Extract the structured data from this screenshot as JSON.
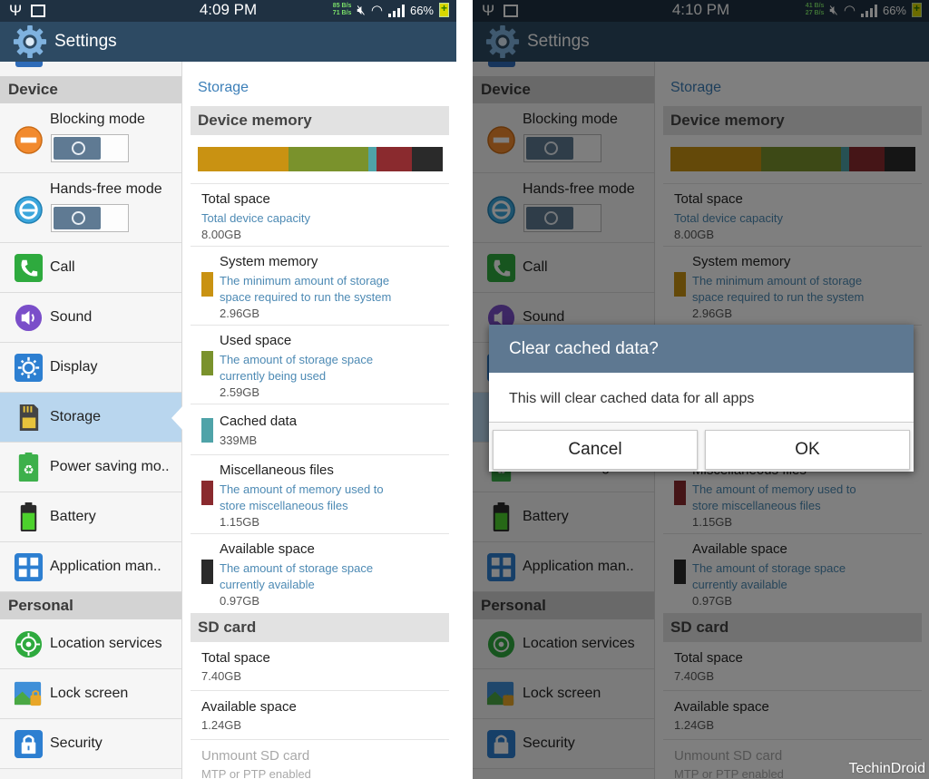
{
  "left": {
    "status": {
      "time": "4:09 PM",
      "battery": "66%",
      "rate_up": "85 B/s",
      "rate_down": "71 B/s"
    },
    "dialog": null
  },
  "right": {
    "status": {
      "time": "4:10 PM",
      "battery": "66%",
      "rate_up": "41 B/s",
      "rate_down": "27 B/s"
    },
    "dialog": {
      "title": "Clear cached data?",
      "message": "This will clear cached data for all apps",
      "cancel": "Cancel",
      "ok": "OK"
    }
  },
  "app": {
    "title": "Settings"
  },
  "nav": {
    "device_header": "Device",
    "personal_header": "Personal",
    "items": [
      {
        "label": "Blocking mode",
        "icon": "blocking-mode-icon"
      },
      {
        "label": "Hands-free mode",
        "icon": "hands-free-icon"
      },
      {
        "label": "Call",
        "icon": "phone-icon"
      },
      {
        "label": "Sound",
        "icon": "speaker-icon"
      },
      {
        "label": "Display",
        "icon": "display-icon"
      },
      {
        "label": "Storage",
        "icon": "sd-card-icon"
      },
      {
        "label": "Power saving mo..",
        "icon": "recycle-icon"
      },
      {
        "label": "Battery",
        "icon": "battery-icon"
      },
      {
        "label": "Application man..",
        "icon": "grid-icon"
      },
      {
        "label": "Location services",
        "icon": "location-icon"
      },
      {
        "label": "Lock screen",
        "icon": "lock-screen-icon"
      },
      {
        "label": "Security",
        "icon": "padlock-icon"
      }
    ],
    "selected": "Storage",
    "toggles": {
      "blocking_mode": "off",
      "hands_free_mode": "off"
    }
  },
  "content": {
    "breadcrumb": "Storage",
    "device_memory": {
      "header": "Device memory",
      "bar_colors": {
        "system": "#c99212",
        "used": "#7a922c",
        "cached": "#4fa3a8",
        "misc": "#8a2a2e",
        "available": "#2a2a2a"
      },
      "bar_fractions": {
        "system": 0.37,
        "used": 0.325,
        "cached": 0.035,
        "misc": 0.145,
        "available": 0.125
      },
      "total": {
        "title": "Total space",
        "desc": "Total device capacity",
        "value": "8.00GB"
      },
      "system": {
        "title": "System memory",
        "desc1": "The minimum amount of storage",
        "desc2": "space required to run the system",
        "value": "2.96GB"
      },
      "used": {
        "title": "Used space",
        "desc1": "The amount of storage space",
        "desc2": "currently being used",
        "value": "2.59GB"
      },
      "cached": {
        "title": "Cached data",
        "value": "339MB"
      },
      "misc": {
        "title": "Miscellaneous files",
        "desc1": "The amount of memory used to",
        "desc2": "store miscellaneous files",
        "value": "1.15GB"
      },
      "available": {
        "title": "Available space",
        "desc1": "The amount of storage space",
        "desc2": "currently available",
        "value": "0.97GB"
      }
    },
    "sd_card": {
      "header": "SD card",
      "total": {
        "title": "Total space",
        "value": "7.40GB"
      },
      "available": {
        "title": "Available space",
        "value": "1.24GB"
      },
      "unmount": {
        "title": "Unmount SD card",
        "value": "MTP or PTP enabled"
      }
    }
  },
  "watermark": "TechinDroid"
}
